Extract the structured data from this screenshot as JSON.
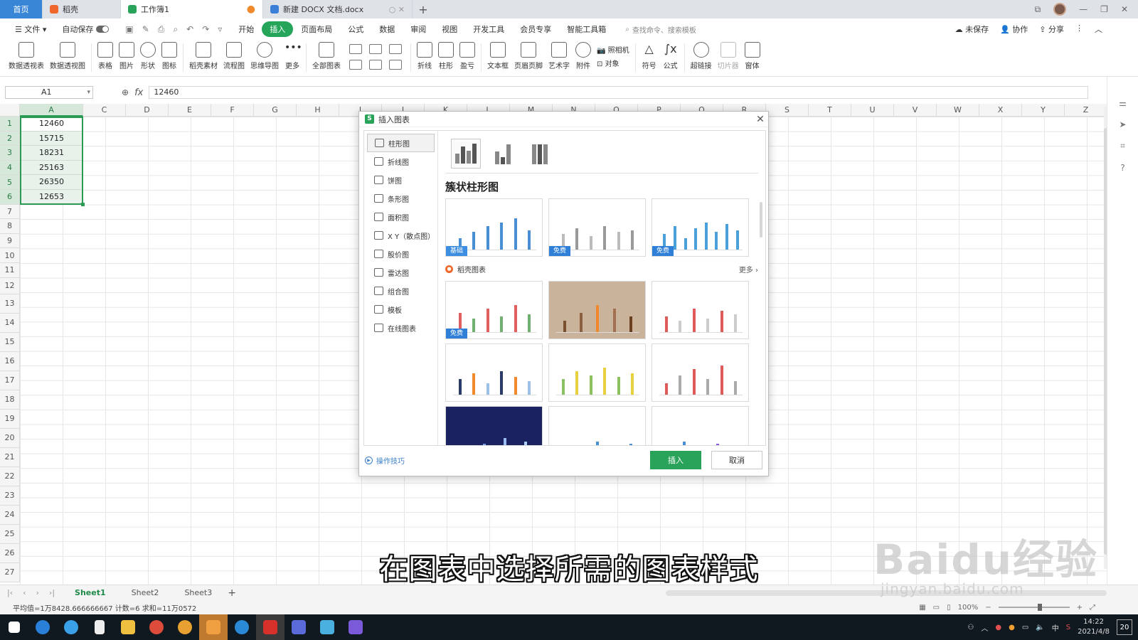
{
  "tabs": [
    {
      "label": "首页"
    },
    {
      "label": "稻壳"
    },
    {
      "label": "工作簿1"
    },
    {
      "label": "新建 DOCX 文档.docx"
    }
  ],
  "menubar": {
    "file": "文件",
    "autosave": "自动保存",
    "items": [
      "开始",
      "插入",
      "页面布局",
      "公式",
      "数据",
      "审阅",
      "视图",
      "开发工具",
      "会员专享",
      "智能工具箱"
    ],
    "active_index": 1,
    "search": "查找命令、搜索模板",
    "unsaved": "未保存",
    "collab": "协作",
    "share": "分享"
  },
  "ribbon": {
    "buttons": [
      "数据透视表",
      "数据透视图",
      "表格",
      "图片",
      "形状",
      "图标",
      "稻壳素材",
      "流程图",
      "思维导图",
      "更多",
      "全部图表"
    ],
    "buttons2": [
      "折线",
      "柱形",
      "盈亏",
      "文本框",
      "页眉页脚",
      "艺术字",
      "附件",
      "照相机",
      "对象",
      "符号",
      "公式",
      "超链接",
      "切片器",
      "窗体"
    ]
  },
  "formula": {
    "cell_ref": "A1",
    "fx": "fx",
    "value": "12460"
  },
  "columns": [
    "A",
    "C",
    "D",
    "E",
    "F",
    "G",
    "H",
    "I",
    "J",
    "K",
    "L",
    "M",
    "N",
    "O",
    "P",
    "Q",
    "R",
    "S",
    "T",
    "U",
    "V",
    "W",
    "X",
    "Y",
    "Z"
  ],
  "rows": [
    "1",
    "2",
    "3",
    "4",
    "5",
    "6",
    "7",
    "8",
    "9",
    "10",
    "11",
    "12",
    "13",
    "14",
    "15",
    "16",
    "17",
    "18",
    "19",
    "20",
    "21",
    "22",
    "23",
    "24",
    "25",
    "26",
    "27"
  ],
  "colA_values": [
    "12460",
    "15715",
    "18231",
    "25163",
    "26350",
    "12653"
  ],
  "dialog": {
    "title": "插入图表",
    "types": [
      "柱形图",
      "折线图",
      "饼图",
      "条形图",
      "面积图",
      "X Y（散点图）",
      "股价图",
      "雷达图",
      "组合图",
      "模板",
      "在线图表"
    ],
    "active_type": 0,
    "category_title": "簇状柱形图",
    "badges": {
      "basic": "基础",
      "free": "免费"
    },
    "docer_label": "稻壳图表",
    "more": "更多 ›",
    "tips": "操作技巧",
    "insert": "插入",
    "cancel": "取消"
  },
  "sheets": [
    "Sheet1",
    "Sheet2",
    "Sheet3"
  ],
  "status": {
    "summary": "平均值=1万8428.666666667  计数=6  求和=11万0572",
    "zoom": "100%"
  },
  "taskbar": {
    "time": "14:22",
    "date": "2021/4/8",
    "lang": "中",
    "notif": "20"
  },
  "subtitle": "在图表中选择所需的图表样式",
  "watermark": {
    "big": "Baidu经验",
    "small": "jingyan.baidu.com"
  },
  "colors": {
    "accent_green": "#2aa35a",
    "home_blue": "#3a86d6",
    "chart_blue": "#4a8fd4",
    "chart_orange": "#f08a2c",
    "chart_red": "#e05a5a"
  }
}
